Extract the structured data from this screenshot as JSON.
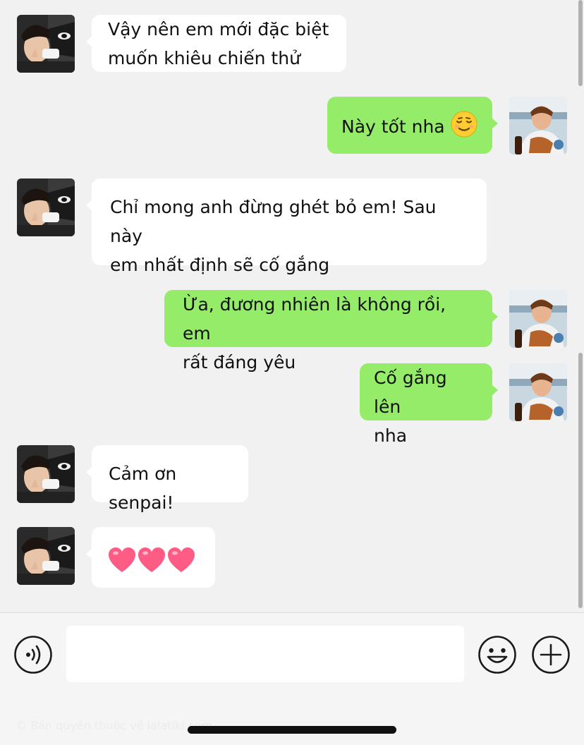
{
  "messages": [
    {
      "side": "in",
      "lines": [
        "Vậy nên em mới đặc biệt",
        "muốn khiêu chiến thử"
      ]
    },
    {
      "side": "out",
      "text": "Này tốt nha",
      "emoji": "relieved-face"
    },
    {
      "side": "in",
      "lines": [
        "Chỉ mong anh đừng ghét bỏ em! Sau này",
        "em nhất định sẽ cố gắng"
      ]
    },
    {
      "side": "out",
      "lines": [
        "Ừa, đương nhiên là không rồi, em",
        "rất đáng yêu"
      ]
    },
    {
      "side": "out",
      "lines": [
        "Cố gắng lên",
        "nha"
      ]
    },
    {
      "side": "in",
      "lines": [
        "Cảm ơn senpai!"
      ]
    },
    {
      "side": "in",
      "emoji": "three-pink-hearts"
    }
  ],
  "input": {
    "value": "",
    "placeholder": ""
  },
  "watermark": "© Bản quyền thuộc về lalatiki.com",
  "colors": {
    "background": "#f1f1f1",
    "incoming_bubble": "#ffffff",
    "outgoing_bubble": "#95ec69",
    "heart": "#ff5c85"
  },
  "icons": {
    "voice": "voice-icon",
    "emoji": "emoji-icon",
    "add": "add-icon"
  }
}
